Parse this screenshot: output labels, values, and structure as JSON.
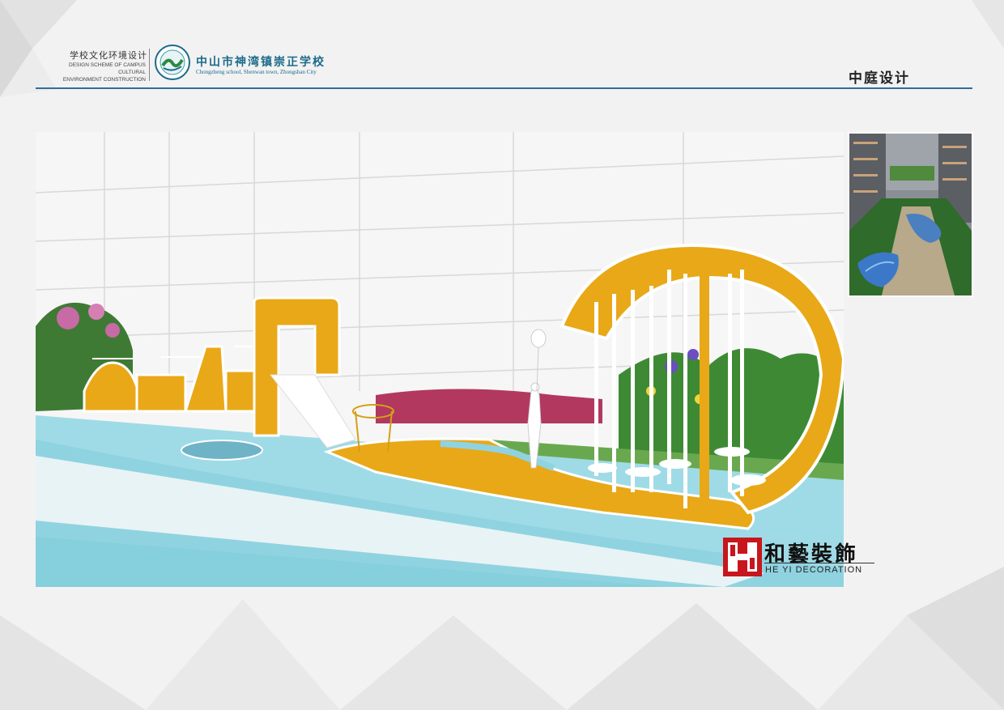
{
  "header": {
    "brand_cn": "学校文化环境设计",
    "brand_en_line1": "DESIGN SCHEME OF CAMPUS CULTURAL",
    "brand_en_line2": "ENVIRONMENT CONSTRUCTION",
    "school_cn": "中山市神湾镇崇正学校",
    "school_en": "Chongzheng school, Shenwan town, Zhongshan City",
    "section_title": "中庭设计"
  },
  "colors": {
    "accent_blue": "#2e6ea3",
    "play_yellow": "#e9a817",
    "pool_blue": "#8fd3e0",
    "logo_red": "#c8161d"
  },
  "watermark": {
    "cn": "和藝裝飾",
    "en": "HE YI DECORATION"
  }
}
